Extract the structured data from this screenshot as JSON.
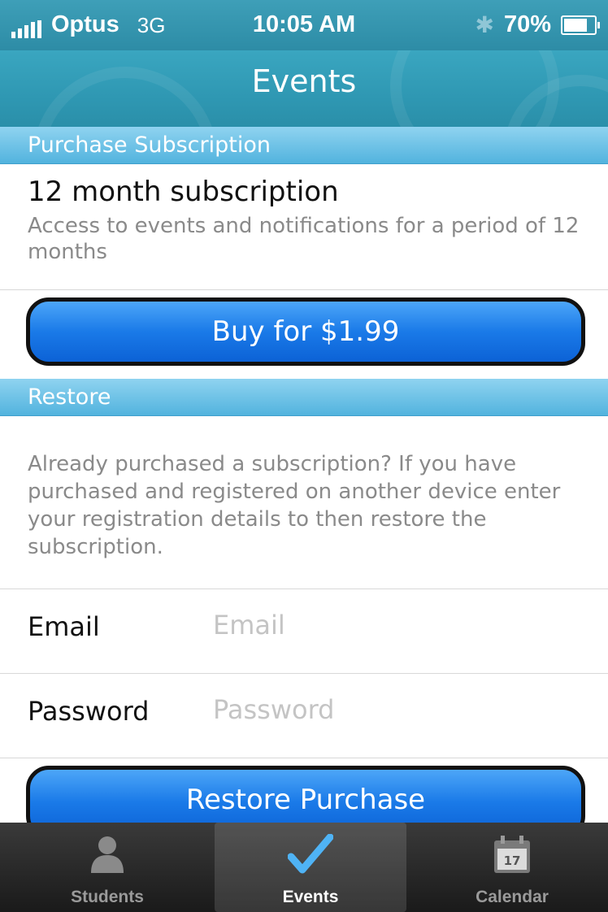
{
  "status_bar": {
    "carrier": "Optus",
    "network": "3G",
    "time": "10:05 AM",
    "battery": "70%",
    "battery_level": 0.7
  },
  "nav": {
    "title": "Events"
  },
  "purchase": {
    "header": "Purchase Subscription",
    "item_title": "12 month subscription",
    "item_description": "Access to events and notifications for a period of 12 months",
    "buy_label": "Buy for $1.99"
  },
  "restore": {
    "header": "Restore",
    "description": "Already purchased a subscription? If you have purchased and registered on another device enter your registration details to then restore the subscription.",
    "email_label": "Email",
    "email_placeholder": "Email",
    "password_label": "Password",
    "password_placeholder": "Password",
    "button_label": "Restore Purchase"
  },
  "tabs": [
    {
      "label": "Students",
      "icon": "person-icon",
      "active": false
    },
    {
      "label": "Events",
      "icon": "checkmark-icon",
      "active": true
    },
    {
      "label": "Calendar",
      "icon": "calendar-icon",
      "active": false,
      "icon_text": "17"
    }
  ]
}
